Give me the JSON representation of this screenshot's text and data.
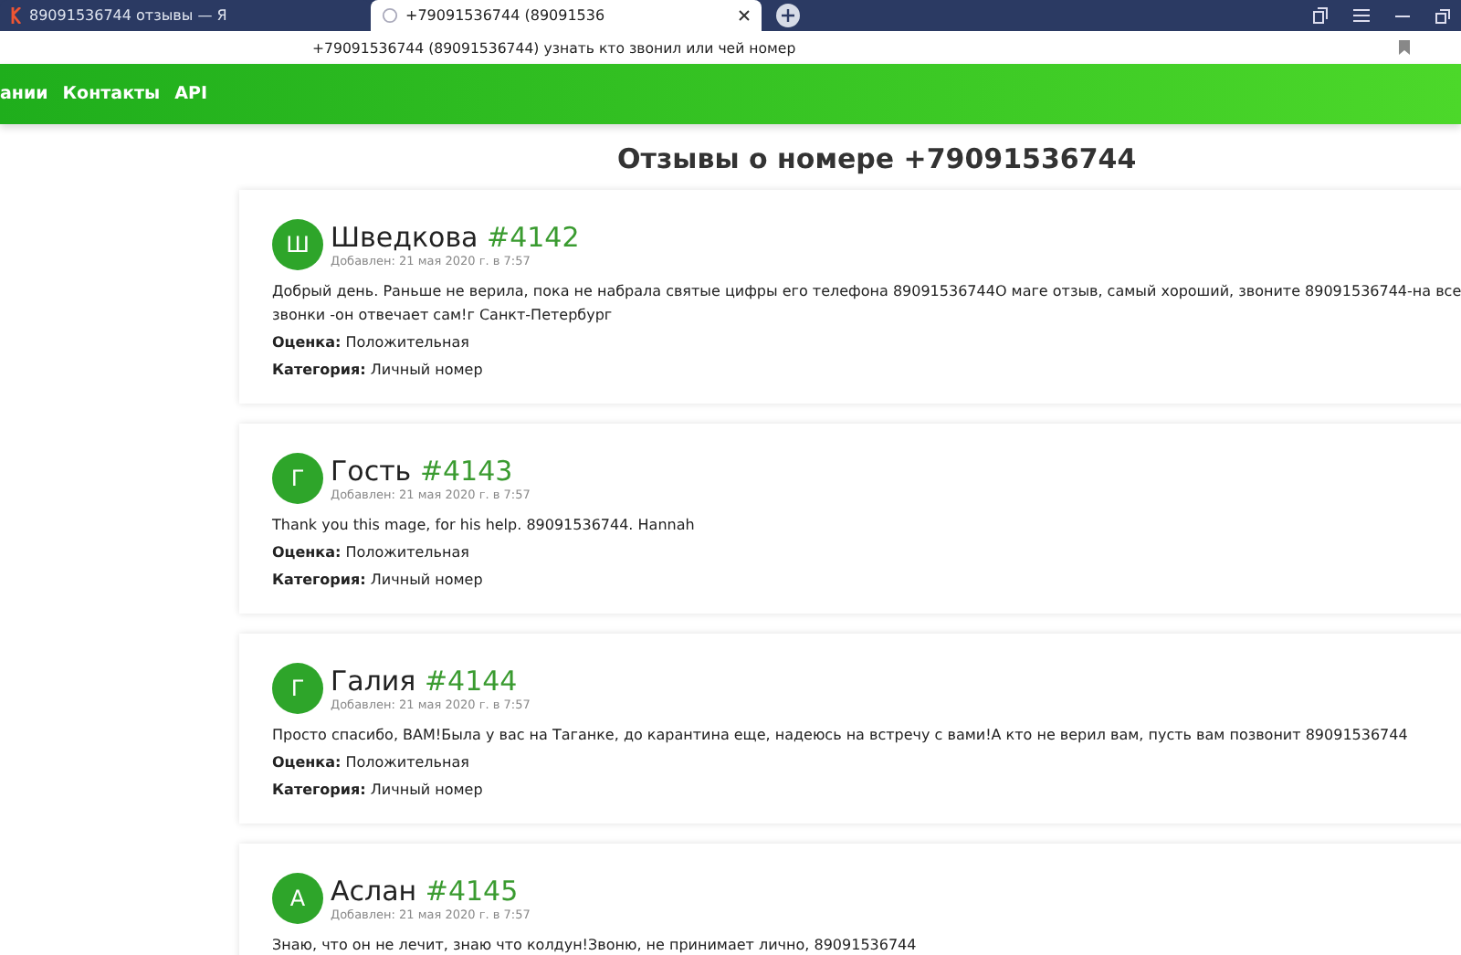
{
  "browser": {
    "tabs": [
      {
        "title": "89091536744 отзывы — Я",
        "selected": false
      },
      {
        "title": "+79091536744 (89091536",
        "selected": true
      }
    ],
    "address": "+79091536744 (89091536744) узнать кто звонил или чей номер"
  },
  "nav": {
    "items": [
      "ании",
      "Контакты",
      "API"
    ]
  },
  "heading": "Отзывы о номере +79091536744",
  "reviews": [
    {
      "initial": "Ш",
      "name": "Шведкова",
      "id": "#4142",
      "date": "Добавлен: 21 мая 2020 г. в 7:57",
      "text": "Добрый день. Раньше не верила, пока не набрала святые цифры его телефона 89091536744О маге отзыв, самый хороший, звоните 89091536744-на все звонки -он отвечает сам!г Санкт-Петербург",
      "rating_label": "Оценка:",
      "rating": "Положительная",
      "category_label": "Категория:",
      "category": "Личный номер"
    },
    {
      "initial": "Г",
      "name": "Гость",
      "id": "#4143",
      "date": "Добавлен: 21 мая 2020 г. в 7:57",
      "text": "Thank you this mage, for his help. 89091536744. Hannah",
      "rating_label": "Оценка:",
      "rating": "Положительная",
      "category_label": "Категория:",
      "category": "Личный номер"
    },
    {
      "initial": "Г",
      "name": "Галия",
      "id": "#4144",
      "date": "Добавлен: 21 мая 2020 г. в 7:57",
      "text": "Просто спасибо, ВАМ!Была у вас на Таганке, до карантина еще, надеюсь на встречу с вами!А кто не верил вам, пусть вам позвонит 89091536744",
      "rating_label": "Оценка:",
      "rating": "Положительная",
      "category_label": "Категория:",
      "category": "Личный номер"
    },
    {
      "initial": "А",
      "name": "Аслан",
      "id": "#4145",
      "date": "Добавлен: 21 мая 2020 г. в 7:57",
      "text": "Знаю, что он не лечит, знаю что колдун!Звоню, не принимает лично, 89091536744"
    }
  ]
}
